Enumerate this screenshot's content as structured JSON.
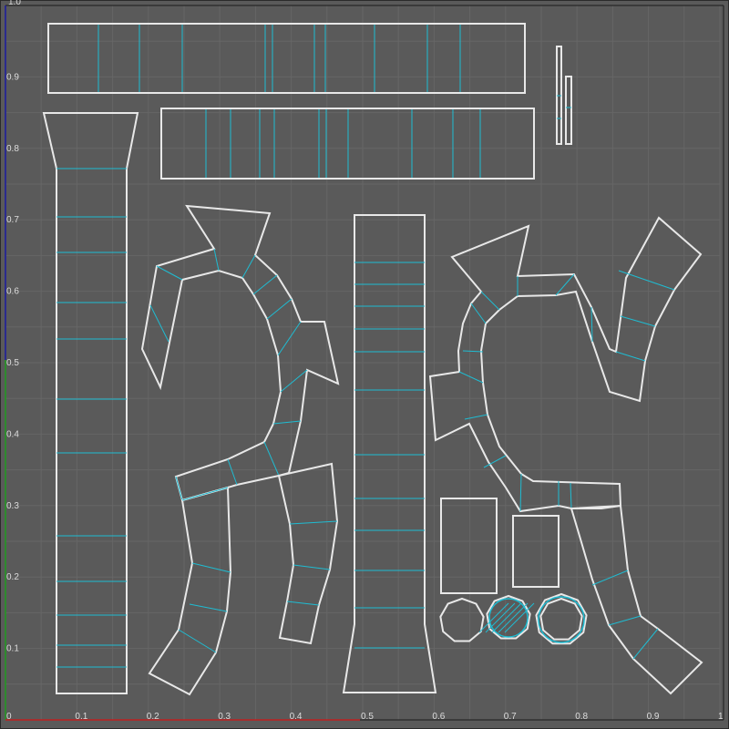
{
  "viewport": {
    "x_ticks": [
      "0",
      "0.1",
      "0.2",
      "0.3",
      "0.4",
      "0.5",
      "0.6",
      "0.7",
      "0.8",
      "0.9",
      "1"
    ],
    "y_ticks": [
      "0.1",
      "0.2",
      "0.3",
      "0.4",
      "0.5",
      "0.6",
      "0.7",
      "0.8",
      "0.9"
    ],
    "corner_top_label": "1.0",
    "corner_bottom_label": "0"
  },
  "colors": {
    "background": "#5a5a5a",
    "grid": "#666666",
    "frame": "#2a2a2a",
    "island_outline": "#e8e8e8",
    "seam_edge": "#1fbcd2",
    "u_axis": "#c02020",
    "v_axis": "#1f9a1f",
    "border_left": "#1a1aa0"
  },
  "uv_layout": {
    "island_count": 16,
    "islands": [
      "top-long-strip",
      "second-long-strip",
      "tiny-strip-a",
      "tiny-strip-b",
      "left-tall-strip",
      "center-tall-strip",
      "left-curved-arm",
      "left-lower-leg",
      "right-curved-arm",
      "right-lower-leg",
      "rect-a",
      "rect-b",
      "circle-plain",
      "circle-hatched",
      "circle-ring"
    ]
  }
}
